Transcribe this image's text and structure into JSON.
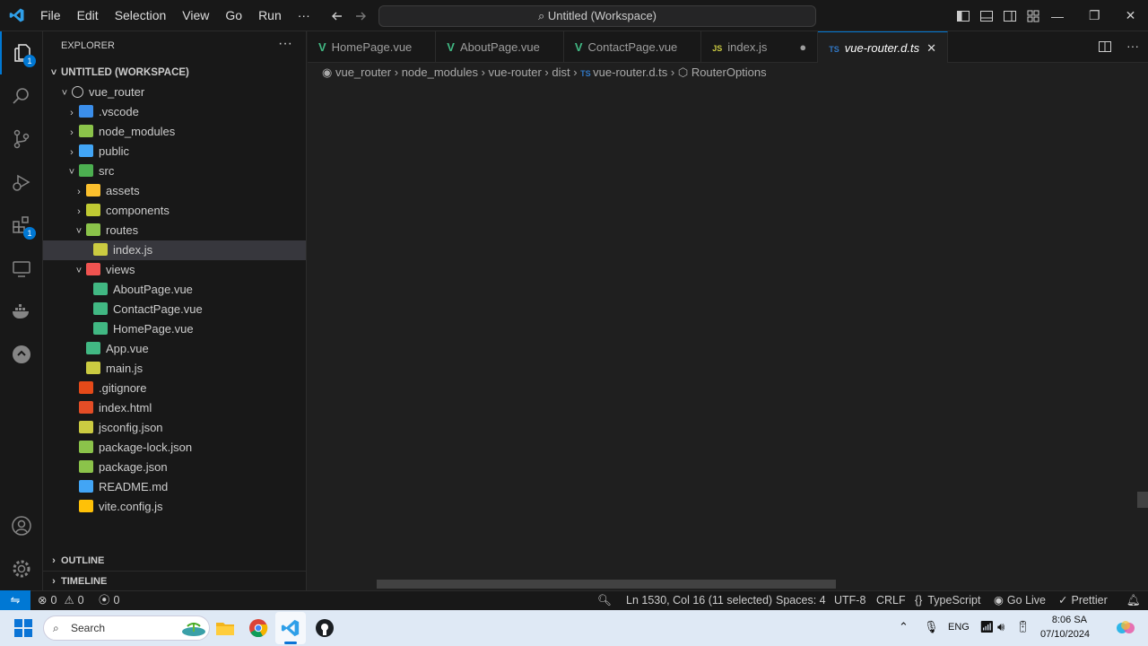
{
  "window": {
    "command_center": "Untitled (Workspace)"
  },
  "menu": [
    "File",
    "Edit",
    "Selection",
    "View",
    "Go",
    "Run",
    "···"
  ],
  "activity": {
    "explorer_badge": "1",
    "extensions_badge": "1"
  },
  "explorer": {
    "title": "EXPLORER",
    "more": "···",
    "workspace": "UNTITLED (WORKSPACE)",
    "items": [
      {
        "label": "vue_router",
        "depth": 1,
        "chev": "˅",
        "color": "#c5c5c5"
      },
      {
        "label": ".vscode",
        "depth": 2,
        "chev": "›",
        "color": "#3b8eea"
      },
      {
        "label": "node_modules",
        "depth": 2,
        "chev": "›",
        "color": "#8bc34a"
      },
      {
        "label": "public",
        "depth": 2,
        "chev": "›",
        "color": "#42a5f5"
      },
      {
        "label": "src",
        "depth": 2,
        "chev": "˅",
        "color": "#4caf50"
      },
      {
        "label": "assets",
        "depth": 3,
        "chev": "›",
        "color": "#fbc02d"
      },
      {
        "label": "components",
        "depth": 3,
        "chev": "›",
        "color": "#c0ca33"
      },
      {
        "label": "routes",
        "depth": 3,
        "chev": "˅",
        "color": "#8bc34a"
      },
      {
        "label": "index.js",
        "depth": 4,
        "chev": "",
        "color": "#cbcb41"
      },
      {
        "label": "views",
        "depth": 3,
        "chev": "˅",
        "color": "#ef5350"
      },
      {
        "label": "AboutPage.vue",
        "depth": 4,
        "chev": "",
        "color": "#41b883"
      },
      {
        "label": "ContactPage.vue",
        "depth": 4,
        "chev": "",
        "color": "#41b883"
      },
      {
        "label": "HomePage.vue",
        "depth": 4,
        "chev": "",
        "color": "#41b883"
      },
      {
        "label": "App.vue",
        "depth": 3,
        "chev": "",
        "color": "#41b883"
      },
      {
        "label": "main.js",
        "depth": 3,
        "chev": "",
        "color": "#cbcb41"
      },
      {
        "label": ".gitignore",
        "depth": 2,
        "chev": "",
        "color": "#e64a19"
      },
      {
        "label": "index.html",
        "depth": 2,
        "chev": "",
        "color": "#e44d26"
      },
      {
        "label": "jsconfig.json",
        "depth": 2,
        "chev": "",
        "color": "#cbcb41"
      },
      {
        "label": "package-lock.json",
        "depth": 2,
        "chev": "",
        "color": "#8bc34a"
      },
      {
        "label": "package.json",
        "depth": 2,
        "chev": "",
        "color": "#8bc34a"
      },
      {
        "label": "README.md",
        "depth": 2,
        "chev": "",
        "color": "#42a5f5"
      },
      {
        "label": "vite.config.js",
        "depth": 2,
        "chev": "",
        "color": "#ffc107"
      }
    ],
    "outline": "OUTLINE",
    "timeline": "TIMELINE"
  },
  "tabs": [
    {
      "label": "HomePage.vue",
      "icon": "V",
      "color": "#41b883"
    },
    {
      "label": "AboutPage.vue",
      "icon": "V",
      "color": "#41b883"
    },
    {
      "label": "ContactPage.vue",
      "icon": "V",
      "color": "#41b883"
    },
    {
      "label": "index.js",
      "icon": "JS",
      "color": "#cbcb41",
      "dot": "●"
    },
    {
      "label": "vue-router.d.ts",
      "icon": "TS",
      "color": "#3178c6",
      "close": "✕"
    }
  ],
  "breadcrumb": [
    "vue_router",
    "node_modules",
    "vue-router",
    "dist",
    "vue-router.d.ts",
    "RouterOptions"
  ],
  "status": {
    "errors": "0",
    "warnings": "0",
    "ports": "0",
    "position": "Ln 1530, Col 16 (11 selected)",
    "spaces": "Spaces: 4",
    "encoding": "UTF-8",
    "eol": "CRLF",
    "language": "TypeScript",
    "golive": "Go Live",
    "prettier": "Prettier"
  },
  "taskbar": {
    "search": "Search",
    "lang": "ENG",
    "time": "8:06 SA",
    "date": "07/10/2024"
  }
}
